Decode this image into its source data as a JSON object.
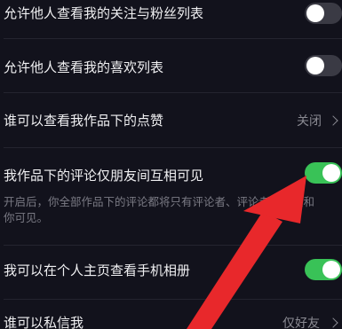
{
  "settings": {
    "rows": [
      {
        "label": "允许他人查看我的关注与粉丝列表",
        "toggle": "off"
      },
      {
        "label": "允许他人查看我的喜欢列表",
        "toggle": "off"
      },
      {
        "label": "谁可以查看我作品下的点赞",
        "value": "关闭"
      },
      {
        "label": "我作品下的评论仅朋友间互相可见",
        "toggle": "on",
        "description_line1": "开启后，你全部作品下的评论都将只有评论者、评论者的朋友和",
        "description_line2": "你可见。"
      },
      {
        "label": "我可以在个人主页查看手机相册",
        "toggle": "on"
      },
      {
        "label": "谁可以私信我",
        "value": "仅好友"
      }
    ]
  },
  "colors": {
    "background": "#12121c",
    "toggle_on": "#39c257",
    "toggle_off": "#3a3a44",
    "annotation_arrow": "#e8282b"
  }
}
